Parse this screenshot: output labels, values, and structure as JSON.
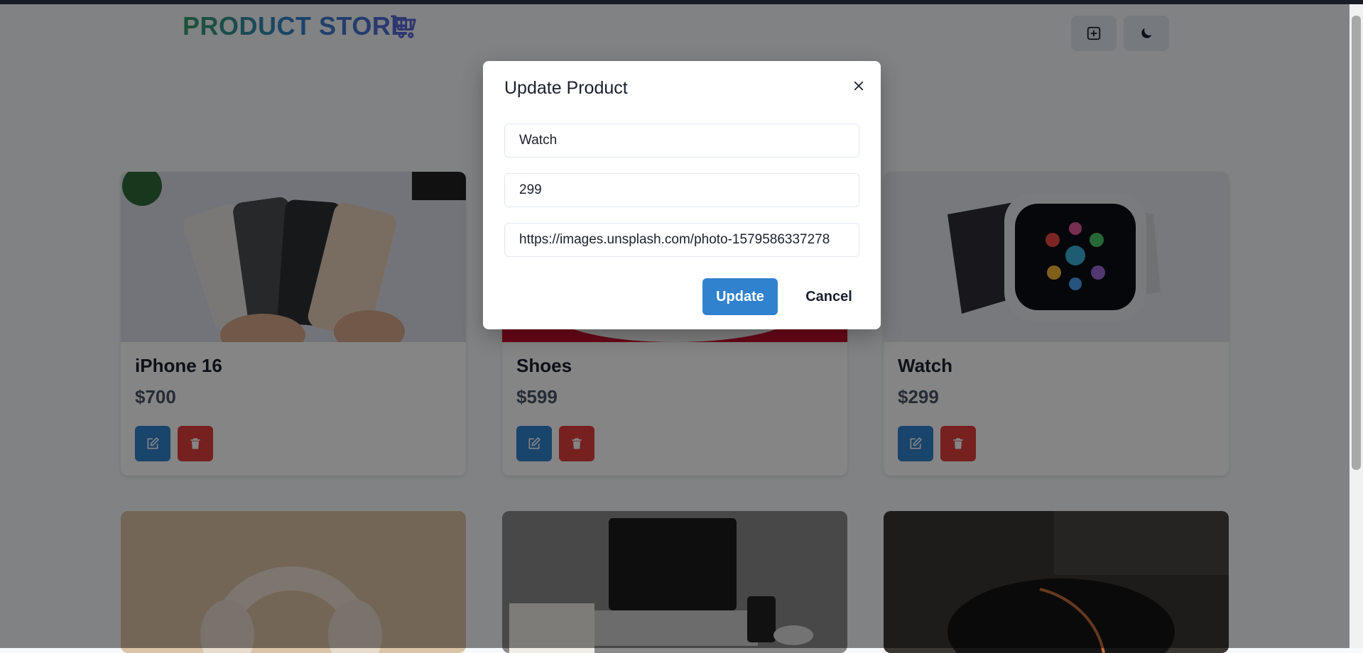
{
  "header": {
    "logo_text": "PRODUCT STORE",
    "logo_icon": "shopping-cart-icon",
    "create_icon": "plus-square-icon",
    "theme_icon": "moon-icon"
  },
  "products": [
    {
      "name": "iPhone 16",
      "price": "$700"
    },
    {
      "name": "Shoes",
      "price": "$599"
    },
    {
      "name": "Watch",
      "price": "$299"
    }
  ],
  "modal": {
    "title": "Update Product",
    "fields": {
      "name": "Watch",
      "price": "299",
      "image": "https://images.unsplash.com/photo-1579586337278"
    },
    "update_label": "Update",
    "cancel_label": "Cancel"
  },
  "colors": {
    "primary": "#3182ce",
    "danger": "#e53e3e",
    "logo_gradient_start": "#38a169",
    "logo_gradient_end": "#5a67d8"
  }
}
